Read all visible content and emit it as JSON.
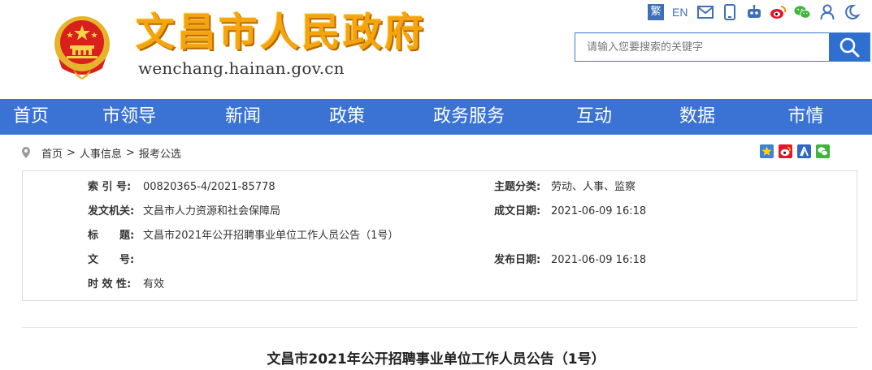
{
  "header": {
    "title": "文昌市人民政府",
    "domain": "wenchang.hainan.gov.cn"
  },
  "toolbar": {
    "traditional_label": "繁",
    "english_label": "EN",
    "icons": [
      "mail-icon",
      "mobile-icon",
      "robot-icon",
      "weibo-icon",
      "wechat-icon",
      "user-icon",
      "dark-mode-icon"
    ]
  },
  "search": {
    "placeholder": "请输入您要搜索的关键字"
  },
  "nav": {
    "items": [
      {
        "label": "首页"
      },
      {
        "label": "市领导"
      },
      {
        "label": "新闻"
      },
      {
        "label": "政策"
      },
      {
        "label": "政务服务"
      },
      {
        "label": "互动"
      },
      {
        "label": "数据"
      },
      {
        "label": "市情"
      }
    ]
  },
  "breadcrumb": {
    "items": [
      "首页",
      "人事信息",
      "报考公选"
    ],
    "separator": ">"
  },
  "share": {
    "icons": [
      "qzone-icon",
      "weibo-share-icon",
      "renren-icon",
      "wechat-share-icon"
    ]
  },
  "info": {
    "index_label": "索 引 号:",
    "index_value": "00820365-4/2021-85778",
    "topic_label": "主题分类:",
    "topic_value": "劳动、人事、监察",
    "issuer_label": "发文机关:",
    "issuer_value": "文昌市人力资源和社会保障局",
    "created_label": "成文日期:",
    "created_value": "2021-06-09 16:18",
    "title_label": "标　　题:",
    "title_value": "文昌市2021年公开招聘事业单位工作人员公告（1号）",
    "docno_label": "文　　号:",
    "docno_value": "",
    "published_label": "发布日期:",
    "published_value": "2021-06-09 16:18",
    "validity_label": "时 效 性:",
    "validity_value": "有效"
  },
  "article": {
    "title": "文昌市2021年公开招聘事业单位工作人员公告（1号）"
  },
  "colors": {
    "brand_blue": "#3a73d3",
    "title_gold": "#f5a410",
    "emblem_red": "#d9201c"
  }
}
